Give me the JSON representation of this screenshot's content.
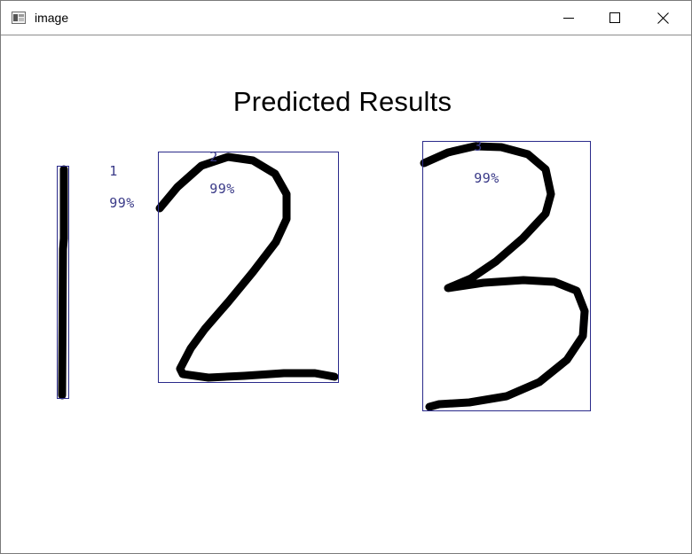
{
  "window": {
    "title": "image",
    "icon": "opencv-window-icon",
    "controls": {
      "minimize_icon": "minimize-icon",
      "maximize_icon": "maximize-icon",
      "close_icon": "close-icon"
    }
  },
  "canvas": {
    "title": "Predicted Results",
    "box_color": "#2a2a8a",
    "stroke_color": "#000000",
    "predictions": [
      {
        "digit": "1",
        "confidence": "99%"
      },
      {
        "digit": "2",
        "confidence": "99%"
      },
      {
        "digit": "3",
        "confidence": "99%"
      }
    ]
  }
}
